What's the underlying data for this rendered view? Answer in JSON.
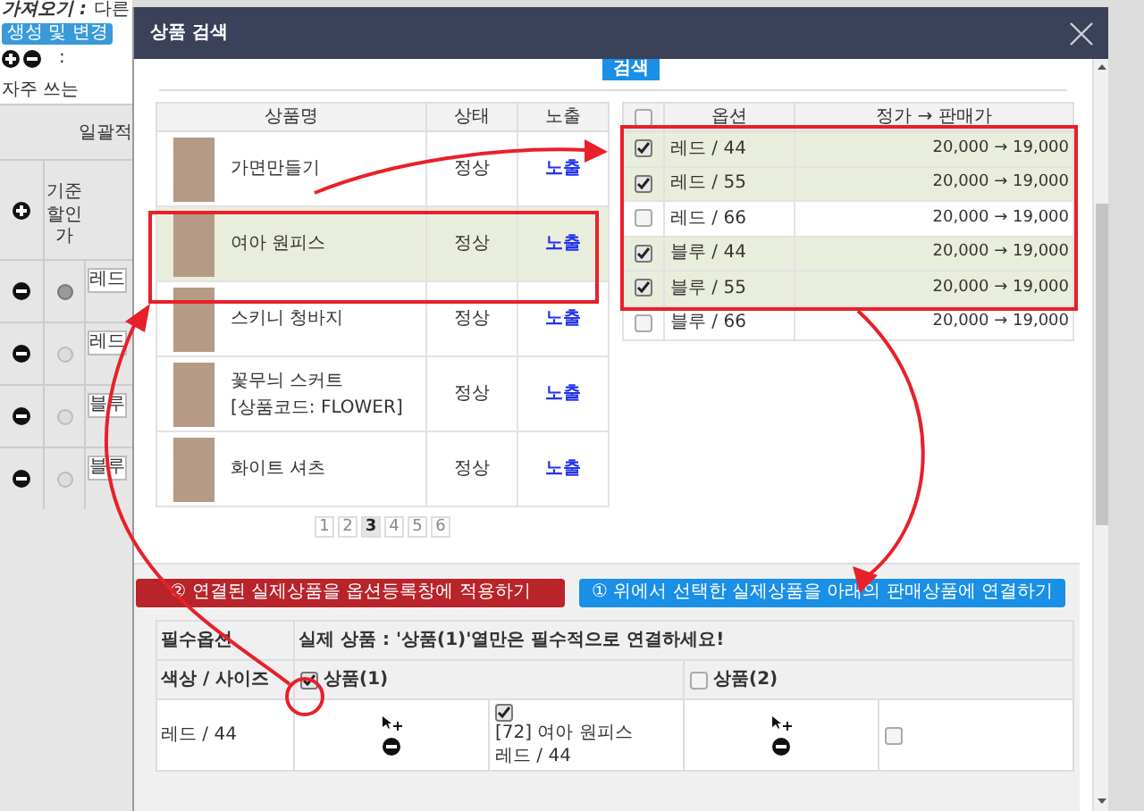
{
  "background": {
    "intro_label": "가져오기 :",
    "intro_text": "다른",
    "generate_button": "생성 및 변경",
    "legend_colon": ":",
    "frequent_text": "자주 쓰는",
    "bulk_header": "일괄적",
    "base_discount_header": "기준할인가",
    "rows": [
      {
        "option": "레드",
        "selected": true
      },
      {
        "option": "레드",
        "selected": false
      },
      {
        "option": "블루",
        "selected": false
      },
      {
        "option": "블루",
        "selected": false
      }
    ]
  },
  "modal": {
    "title": "상품 검색",
    "search_button": "검색"
  },
  "products": {
    "columns": [
      "상품명",
      "상태",
      "노출"
    ],
    "rows": [
      {
        "name": "가면만들기",
        "status": "정상",
        "exposure": "노출",
        "selected": false
      },
      {
        "name": "여아 원피스",
        "status": "정상",
        "exposure": "노출",
        "selected": true
      },
      {
        "name": "스키니 청바지",
        "status": "정상",
        "exposure": "노출",
        "selected": false
      },
      {
        "name": "꽃무늬 스커트",
        "code": "[상품코드: FLOWER]",
        "status": "정상",
        "exposure": "노출",
        "selected": false
      },
      {
        "name": "화이트 셔츠",
        "status": "정상",
        "exposure": "노출",
        "selected": false
      }
    ]
  },
  "pagination": [
    {
      "label": "1",
      "selected": false
    },
    {
      "label": "2",
      "selected": false
    },
    {
      "label": "3",
      "selected": true
    },
    {
      "label": "4",
      "selected": false
    },
    {
      "label": "5",
      "selected": false
    },
    {
      "label": "6",
      "selected": false
    }
  ],
  "options": {
    "columns": [
      "옵션",
      "정가 → 판매가"
    ],
    "all_checked": false,
    "rows": [
      {
        "label": "레드 / 44",
        "price": "20,000 → 19,000",
        "checked": true
      },
      {
        "label": "레드 / 55",
        "price": "20,000 → 19,000",
        "checked": true
      },
      {
        "label": "레드 / 66",
        "price": "20,000 → 19,000",
        "checked": false
      },
      {
        "label": "블루 / 44",
        "price": "20,000 → 19,000",
        "checked": true
      },
      {
        "label": "블루 / 55",
        "price": "20,000 → 19,000",
        "checked": true
      },
      {
        "label": "블루 / 66",
        "price": "20,000 → 19,000",
        "checked": false
      }
    ]
  },
  "actions": {
    "apply_button": "② 연결된 실제상품을 옵션등록창에 적용하기",
    "link_button": "① 위에서 선택한 실제상품을 아래의 판매상품에 연결하기"
  },
  "mapping": {
    "required_label": "필수옵션",
    "notice": "실제 상품 : '상품(1)'열만은 필수적으로 연결하세요!",
    "option_header": "색상 / 사이즈",
    "products": [
      {
        "label": "상품(1)",
        "checked": true
      },
      {
        "label": "상품(2)",
        "checked": false
      }
    ],
    "rows": [
      {
        "option": "레드 / 44",
        "cells": [
          {
            "checked": true,
            "lines": [
              "[72] 여아 원피스",
              "레드 / 44"
            ]
          },
          {
            "checked": false
          }
        ]
      }
    ]
  }
}
